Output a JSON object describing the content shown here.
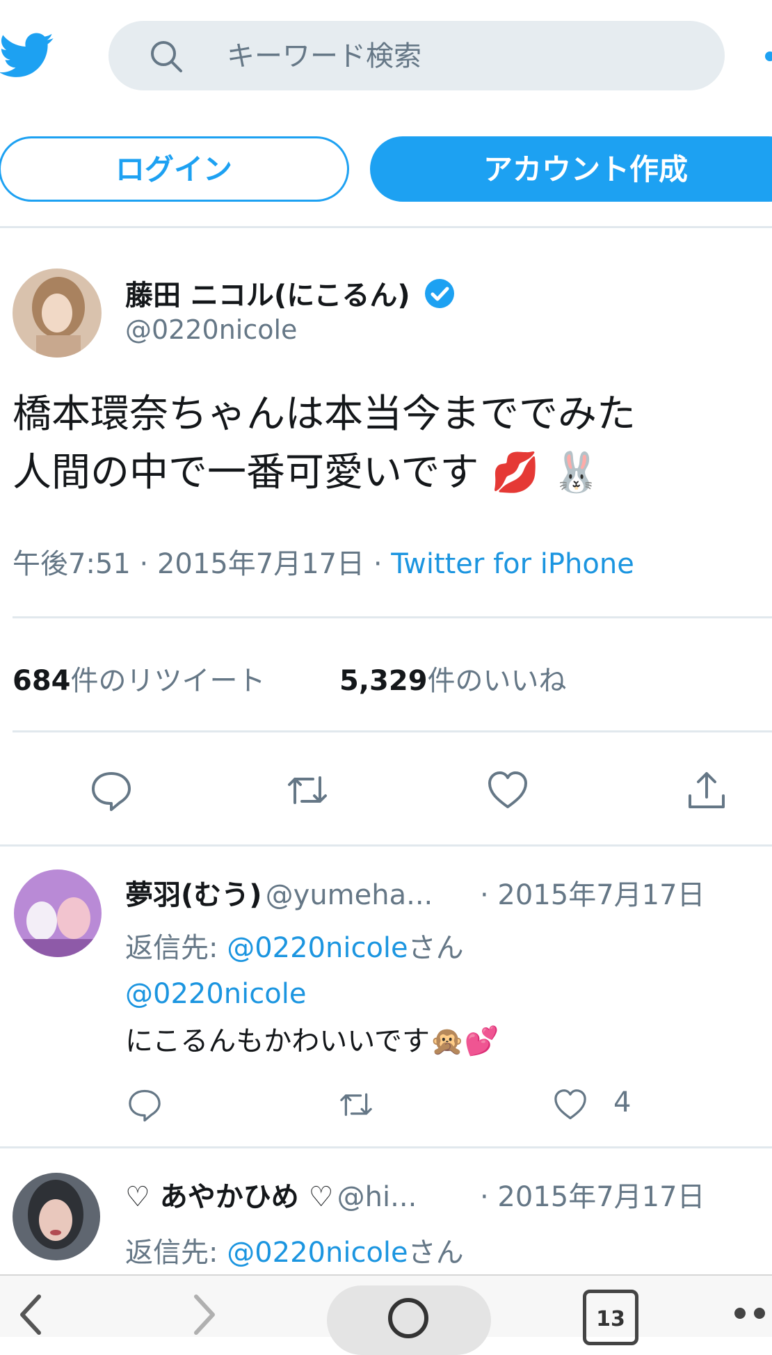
{
  "header": {
    "search_placeholder": "キーワード検索",
    "login_label": "ログイン",
    "signup_label": "アカウント作成",
    "accent_color": "#1da1f2"
  },
  "tweet": {
    "display_name": "藤田 ニコル(にこるん)",
    "handle": "@0220nicole",
    "verified": true,
    "text_line1": "橋本環奈ちゃんは本当今まででみた",
    "text_line2": "人間の中で一番可愛いです",
    "emoji": [
      "💋",
      "🐰"
    ],
    "time": "午後7:51",
    "date": "2015年7月17日",
    "source": "Twitter for iPhone",
    "retweet_count": "684",
    "retweet_label": "件のリツイート",
    "like_count": "5,329",
    "like_label": "件のいいね"
  },
  "replies": [
    {
      "display_name": "夢羽(むう)",
      "handle": "@yumeha...",
      "date": "· 2015年7月17日",
      "reply_prefix": "返信先: ",
      "reply_to": "@0220nicole",
      "reply_suffix": "さん",
      "mention": "@0220nicole",
      "text": "にこるんもかわいいです",
      "emoji": [
        "🙊",
        "💕"
      ],
      "like_count": "4"
    },
    {
      "display_name": "♡ あやかひめ ♡",
      "handle": "@hi...",
      "date": "· 2015年7月17日",
      "reply_prefix": "返信先: ",
      "reply_to": "@0220nicole",
      "reply_suffix": "さん"
    }
  ],
  "browser_bar": {
    "tab_count": "13",
    "icons": [
      "back-icon",
      "forward-icon",
      "search-icon",
      "tabs-icon",
      "more-icon"
    ]
  }
}
